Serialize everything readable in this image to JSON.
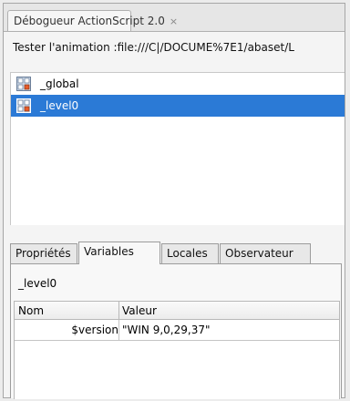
{
  "panel": {
    "tab_title": "Débogueur ActionScript 2.0",
    "close_glyph": "×"
  },
  "movie": {
    "path": "Tester l'animation :file:///C|/DOCUME%7E1/abaset/L"
  },
  "tree": {
    "items": [
      {
        "label": "_global",
        "icon": "movieclip-icon",
        "selected": false
      },
      {
        "label": "_level0",
        "icon": "movieclip-icon",
        "selected": true
      }
    ]
  },
  "tabs": [
    {
      "label": "Propriétés",
      "active": false
    },
    {
      "label": "Variables",
      "active": true
    },
    {
      "label": "Locales",
      "active": false
    },
    {
      "label": "Observateur",
      "active": false
    }
  ],
  "variables": {
    "scope": "_level0",
    "columns": {
      "name": "Nom",
      "value": "Valeur"
    },
    "rows": [
      {
        "name": "$version",
        "value": "\"WIN 9,0,29,37\""
      }
    ]
  },
  "colors": {
    "selection": "#2b7ad6"
  }
}
